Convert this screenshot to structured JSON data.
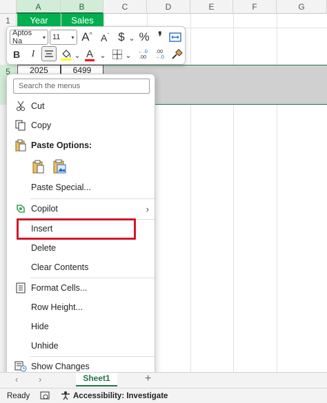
{
  "columns": [
    "A",
    "B",
    "C",
    "D",
    "E",
    "F",
    "G"
  ],
  "rows": [
    "1",
    "5"
  ],
  "cells": {
    "a1": "Year",
    "b1": "Sales",
    "a5": "2025",
    "b5": "6499"
  },
  "mini_toolbar": {
    "font_name": "Aptos Na",
    "font_size": "11",
    "grow_font": "A",
    "shrink_font": "A",
    "currency": "$",
    "percent": "%",
    "comma": "❜",
    "bold": "B",
    "italic": "I",
    "fill_color": "#ffff00",
    "font_color": "#ff0000",
    "decrease_decimals": "←.0\n.00",
    "increase_decimals": ".00\n→.0"
  },
  "context_menu": {
    "search_placeholder": "Search the menus",
    "cut": "Cut",
    "copy": "Copy",
    "paste_options": "Paste Options:",
    "paste_special": "Paste Special...",
    "copilot": "Copilot",
    "insert": "Insert",
    "delete": "Delete",
    "clear_contents": "Clear Contents",
    "format_cells": "Format Cells...",
    "row_height": "Row Height...",
    "hide": "Hide",
    "unhide": "Unhide",
    "show_changes": "Show Changes"
  },
  "sheet_tab": "Sheet1",
  "add_sheet": "+",
  "status": {
    "ready": "Ready",
    "accessibility": "Accessibility: Investigate"
  },
  "colors": {
    "excel_green": "#217346",
    "header_fill": "#00b050",
    "selection_fill": "#d0d0d0",
    "insert_outline": "#d1172a"
  }
}
